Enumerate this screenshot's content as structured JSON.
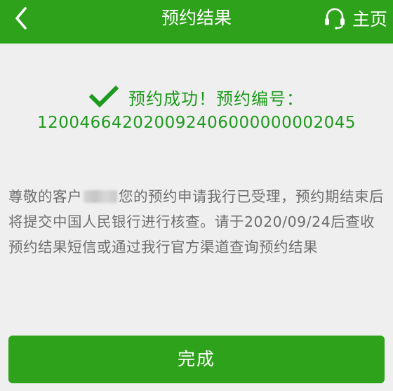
{
  "header": {
    "title": "预约结果",
    "home_label": "主页"
  },
  "status": {
    "message": "预约成功！预约编号：",
    "reservation_number": "120046642020092406000000002045"
  },
  "message": {
    "prefix": "尊敬的客户",
    "body": "您的预约申请我行已受理，预约期结束后将提交中国人民银行进行核查。请于2020/09/24后查收预约结果短信或通过我行官方渠道查询预约结果"
  },
  "footer": {
    "done_label": "完成"
  },
  "colors": {
    "primary_green": "#2fa21c",
    "success_green": "#1d9a1d",
    "background": "#efefef",
    "text_gray": "#6e6e6e"
  }
}
